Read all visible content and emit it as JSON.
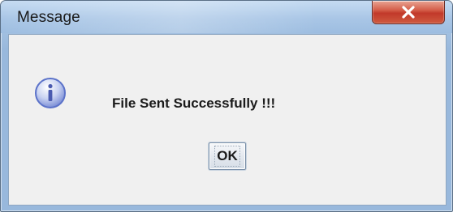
{
  "window": {
    "title": "Message",
    "close_icon": "close-icon"
  },
  "dialog": {
    "icon": "info-icon",
    "message": "File Sent Successfully !!!",
    "ok_label": "OK"
  },
  "colors": {
    "titlebar": "#a9c6e6",
    "close_button": "#c2392a",
    "client_background": "#f0f0f0",
    "info_icon": "#5b72c9"
  }
}
